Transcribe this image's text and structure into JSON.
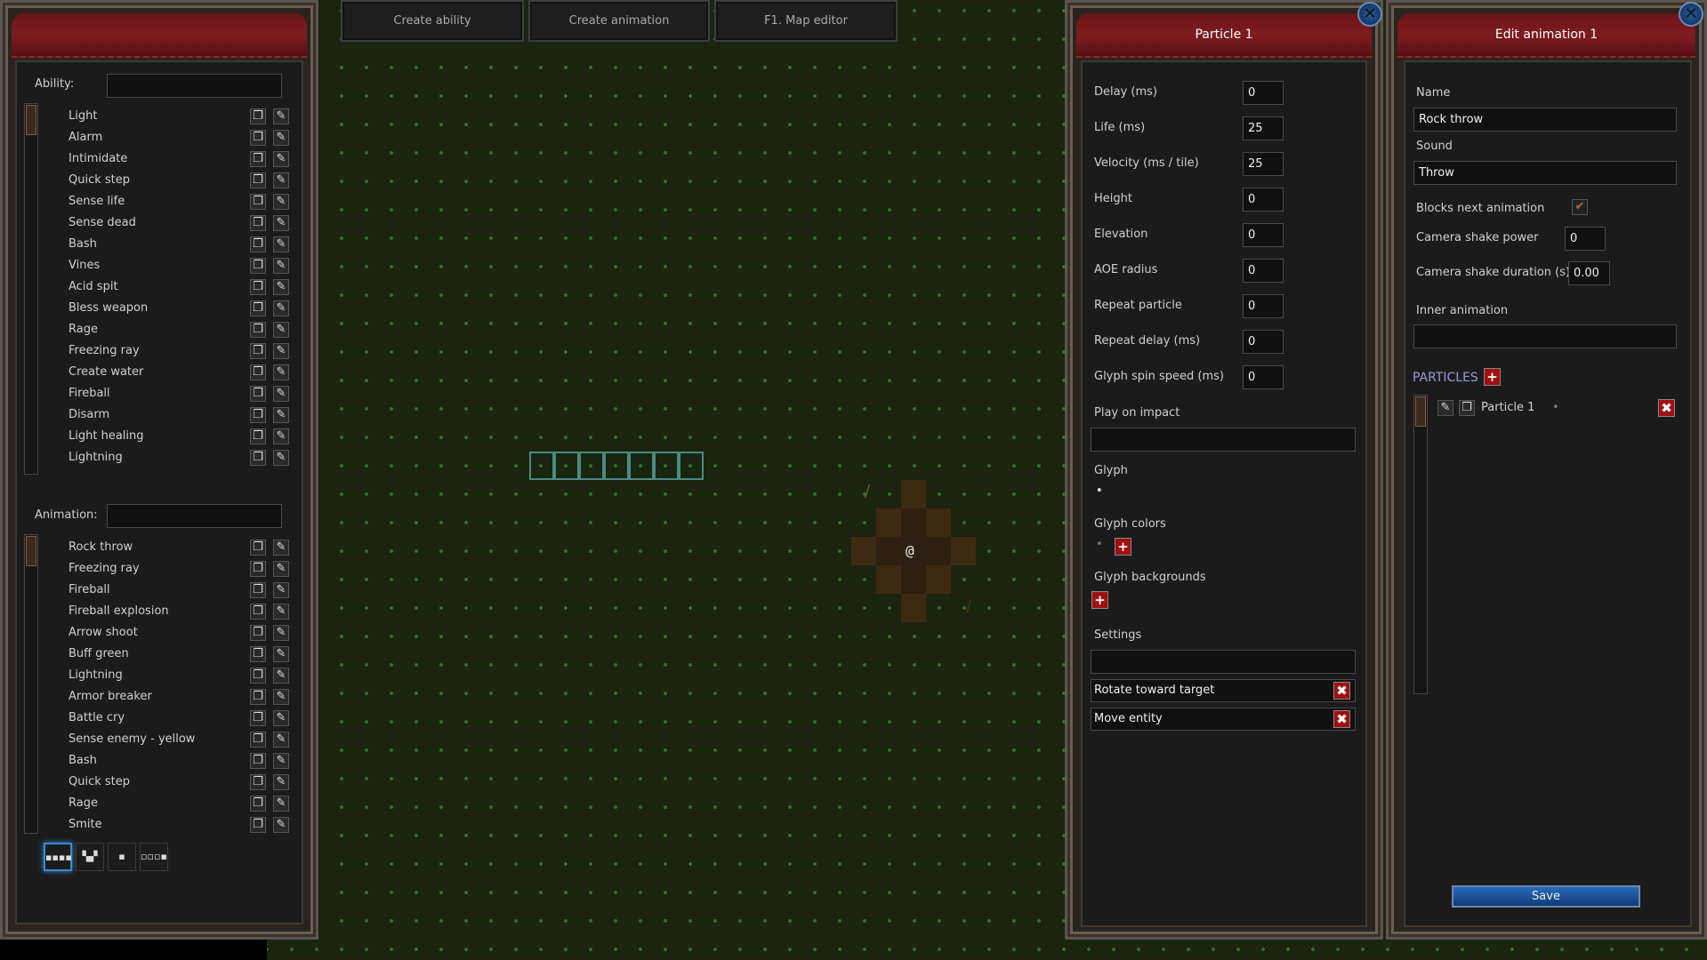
{
  "top_buttons": [
    "Create ability",
    "Create animation",
    "F1. Map editor"
  ],
  "left": {
    "ability_label": "Ability:",
    "ability_search": "",
    "abilities": [
      "Light",
      "Alarm",
      "Intimidate",
      "Quick step",
      "Sense life",
      "Sense dead",
      "Bash",
      "Vines",
      "Acid spit",
      "Bless weapon",
      "Rage",
      "Freezing ray",
      "Create water",
      "Fireball",
      "Disarm",
      "Light healing",
      "Lightning"
    ],
    "animation_label": "Animation:",
    "animation_search": "",
    "animations": [
      "Rock throw",
      "Freezing ray",
      "Fireball",
      "Fireball explosion",
      "Arrow shoot",
      "Buff green",
      "Lightning",
      "Armor breaker",
      "Battle cry",
      "Sense enemy - yellow",
      "Bash",
      "Quick step",
      "Rage",
      "Smite"
    ],
    "mode_buttons": [
      {
        "icon": "line-pattern-icon",
        "glyph": "▪▪▪▪",
        "active": true
      },
      {
        "icon": "cone-pattern-icon",
        "glyph": "▚▞",
        "active": false
      },
      {
        "icon": "single-pattern-icon",
        "glyph": "▪",
        "active": false
      },
      {
        "icon": "projectile-pattern-icon",
        "glyph": "▫▫▫▪",
        "active": false
      }
    ]
  },
  "map": {
    "player_glyph": "@",
    "projectile_glyph": "/",
    "colors": {
      "grass": "#1a2510",
      "dot": "#2f7a2a",
      "aoe": "#3d2a10",
      "highlight": "#4a8a80"
    }
  },
  "particle": {
    "title": "Particle 1",
    "fields": [
      {
        "label": "Delay (ms)",
        "value": "0"
      },
      {
        "label": "Life (ms)",
        "value": "25"
      },
      {
        "label": "Velocity (ms / tile)",
        "value": "25"
      },
      {
        "label": "Height",
        "value": "0"
      },
      {
        "label": "Elevation",
        "value": "0"
      },
      {
        "label": "AOE radius",
        "value": "0"
      },
      {
        "label": "Repeat particle",
        "value": "0"
      },
      {
        "label": "Repeat delay (ms)",
        "value": "0"
      },
      {
        "label": "Glyph spin speed (ms)",
        "value": "0"
      }
    ],
    "play_on_impact_label": "Play on impact",
    "play_on_impact": "",
    "glyph_label": "Glyph",
    "glyph": "•",
    "glyph_colors_label": "Glyph colors",
    "glyph_color_dot": "•",
    "glyph_backgrounds_label": "Glyph backgrounds",
    "settings_label": "Settings",
    "settings_input": "",
    "settings": [
      "Rotate toward target",
      "Move entity"
    ]
  },
  "edit": {
    "title": "Edit animation 1",
    "name_label": "Name",
    "name": "Rock throw",
    "sound_label": "Sound",
    "sound": "Throw",
    "blocks_label": "Blocks next animation",
    "blocks_checked": true,
    "shake_power_label": "Camera shake power",
    "shake_power": "0",
    "shake_duration_label": "Camera shake duration (s)",
    "shake_duration": "0.00",
    "inner_label": "Inner animation",
    "inner": "",
    "particles_label": "PARTICLES",
    "particles": [
      {
        "name": "Particle 1",
        "dot": "•"
      }
    ],
    "save": "Save"
  }
}
